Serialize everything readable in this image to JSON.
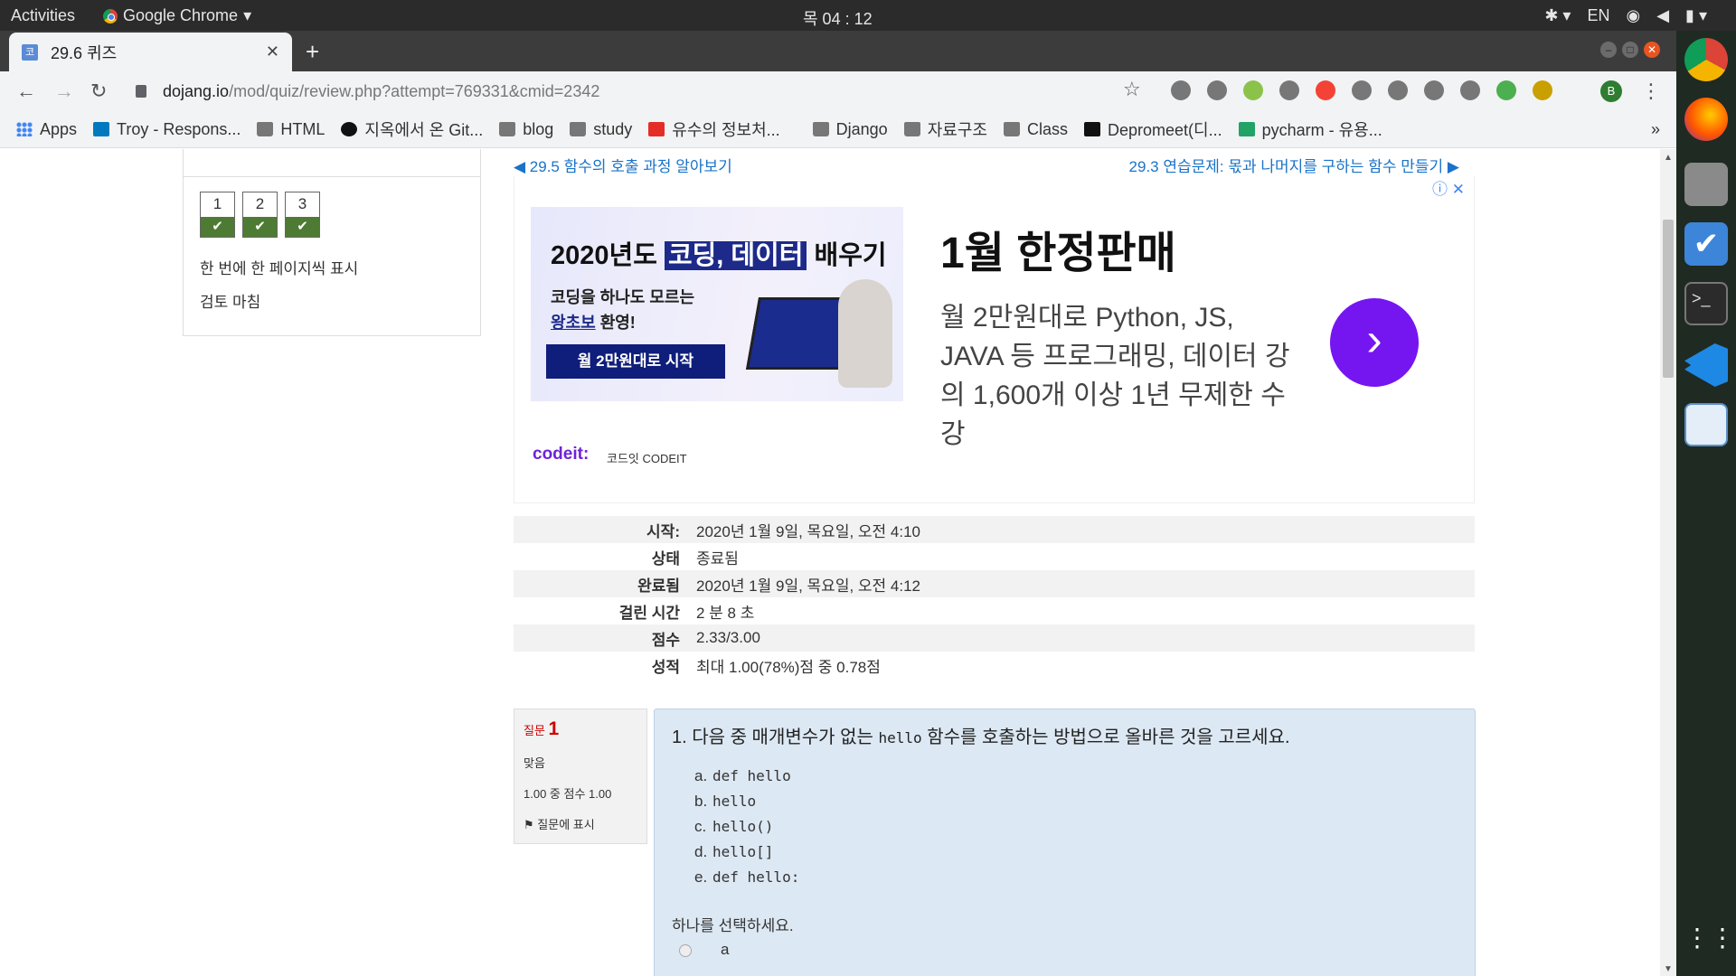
{
  "os": {
    "activities": "Activities",
    "app_name": "Google Chrome",
    "clock": "목 04 : 12",
    "lang": "EN"
  },
  "tab": {
    "title": "29.6 퀴즈",
    "favicon": "코"
  },
  "address": {
    "host": "dojang.io",
    "path": "/mod/quiz/review.php?attempt=769331&cmid=2342"
  },
  "profile_initial": "B",
  "bookmarks": [
    {
      "label": "Apps",
      "icon": "apps"
    },
    {
      "label": "Troy - Respons...",
      "icon": "tr"
    },
    {
      "label": "HTML",
      "icon": "folder"
    },
    {
      "label": "지옥에서 온 Git...",
      "icon": "dot"
    },
    {
      "label": "blog",
      "icon": "folder"
    },
    {
      "label": "study",
      "icon": "folder"
    },
    {
      "label": "유수의 정보처...",
      "icon": "yt"
    },
    {
      "label": "Django",
      "icon": "folder"
    },
    {
      "label": "자료구조",
      "icon": "folder"
    },
    {
      "label": "Class",
      "icon": "folder"
    },
    {
      "label": "Depromeet(디...",
      "icon": "m"
    },
    {
      "label": "pycharm - 유용...",
      "icon": "py"
    }
  ],
  "bookmarks_more": "»",
  "quiz_nav": {
    "buttons": [
      "1",
      "2",
      "3"
    ],
    "show_one_page": "한 번에 한 페이지씩 표시",
    "finish_review": "검토 마침"
  },
  "page_nav": {
    "prev": "◀ 29.5 함수의 호출 과정 알아보기",
    "next": "29.3 연습문제: 몫과 나머지를 구하는 함수 만들기 ▶"
  },
  "ad": {
    "headline_pre": "2020년도 ",
    "headline_hl": "코딩, 데이터",
    "headline_post": " 배우기",
    "line1": "코딩을 하나도 모르는",
    "line2_u": "왕초보",
    "line2_rest": " 환영!",
    "button": "월 2만원대로 시작",
    "brand": "codeit:",
    "brand_sub": "코드잇 CODEIT",
    "title": "1월 한정판매",
    "desc": "월 2만원대로 Python, JS, JAVA 등 프로그래밍, 데이터 강의 1,600개 이상 1년 무제한 수강",
    "info": "ⓘ ✕"
  },
  "summary": [
    {
      "k": "시작:",
      "v": "2020년 1월 9일, 목요일, 오전 4:10"
    },
    {
      "k": "상태",
      "v": "종료됨"
    },
    {
      "k": "완료됨",
      "v": "2020년 1월 9일, 목요일, 오전 4:12"
    },
    {
      "k": "걸린 시간",
      "v": "2 분 8 초"
    },
    {
      "k": "점수",
      "v": "2.33/3.00"
    },
    {
      "k": "성적",
      "v": "최대 1.00(78%)점 중 0.78점"
    }
  ],
  "question": {
    "label": "질문",
    "number": "1",
    "status": "맞음",
    "score": "1.00 중 점수 1.00",
    "flag": "질문에 표시",
    "text_pre": "1. 다음 중 매개변수가 없는 ",
    "text_code": "hello",
    "text_post": " 함수를 호출하는 방법으로 올바른 것을 고르세요.",
    "options": [
      {
        "letter": "a.",
        "code": "def hello"
      },
      {
        "letter": "b.",
        "code": "hello"
      },
      {
        "letter": "c.",
        "code": "hello()"
      },
      {
        "letter": "d.",
        "code": "hello[]"
      },
      {
        "letter": "e.",
        "code": "def hello:"
      }
    ],
    "select_prompt": "하나를 선택하세요.",
    "first_answer": "a"
  }
}
